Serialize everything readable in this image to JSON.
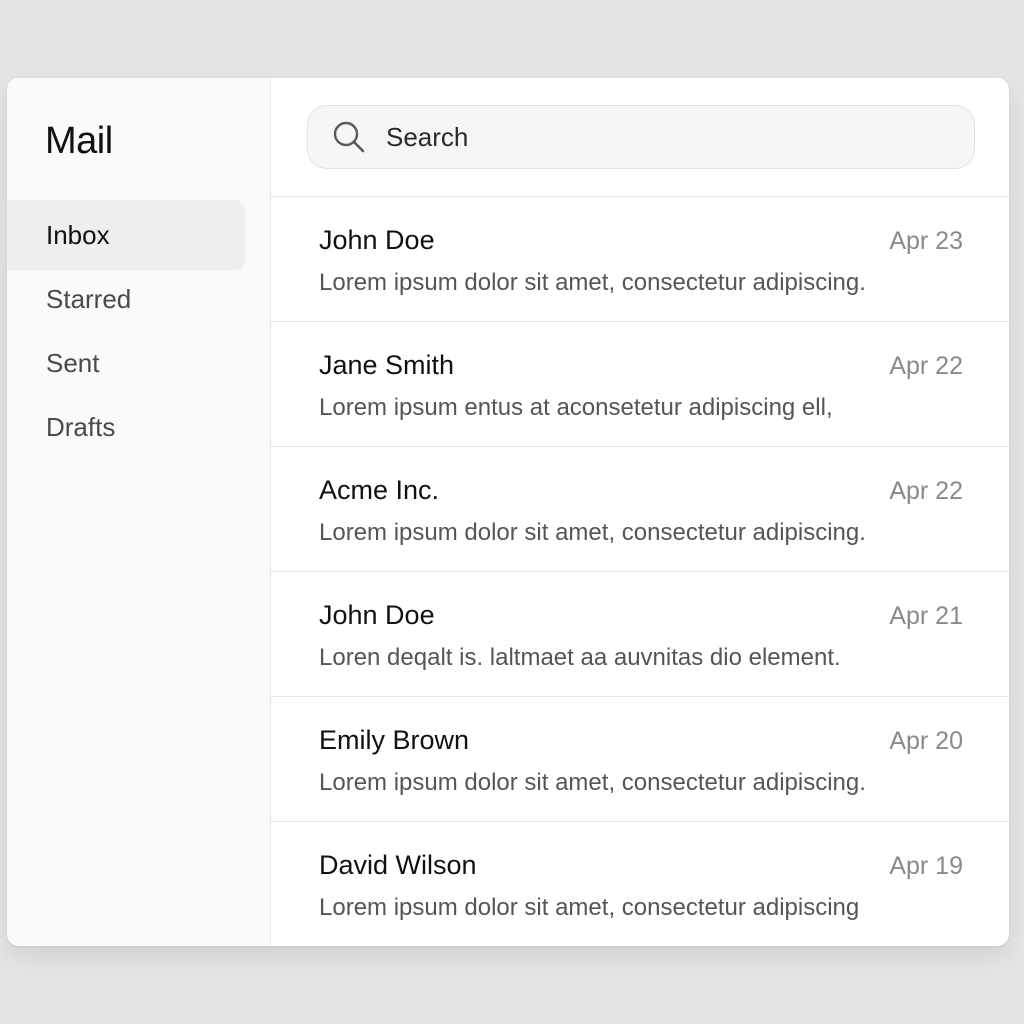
{
  "app": {
    "title": "Mail"
  },
  "sidebar": {
    "items": [
      {
        "label": "Inbox",
        "active": true
      },
      {
        "label": "Starred",
        "active": false
      },
      {
        "label": "Sent",
        "active": false
      },
      {
        "label": "Drafts",
        "active": false
      }
    ]
  },
  "search": {
    "placeholder": "Search",
    "icon": "search-icon"
  },
  "messages": [
    {
      "sender": "John Doe",
      "date": "Apr 23",
      "preview": "Lorem ipsum dolor sit amet, consectetur adipiscing."
    },
    {
      "sender": "Jane Smith",
      "date": "Apr 22",
      "preview": "Lorem ipsum entus at aconsetetur adipiscing ell,"
    },
    {
      "sender": "Acme Inc.",
      "date": "Apr 22",
      "preview": "Lorem ipsum dolor sit amet, consectetur adipiscing."
    },
    {
      "sender": "John Doe",
      "date": "Apr 21",
      "preview": "Loren deqalt is. laltmaet aa auvnitas dio element."
    },
    {
      "sender": "Emily Brown",
      "date": "Apr 20",
      "preview": "Lorem ipsum dolor sit amet, consectetur adipiscing."
    },
    {
      "sender": "David Wilson",
      "date": "Apr 19",
      "preview": "Lorem ipsum dolor sit amet, consectetur adipiscing"
    }
  ],
  "colors": {
    "background": "#e6e6e6",
    "window": "#ffffff",
    "sidebar": "#fafafa",
    "active_item": "#eeeeee",
    "date_text": "#8a8a8a"
  }
}
